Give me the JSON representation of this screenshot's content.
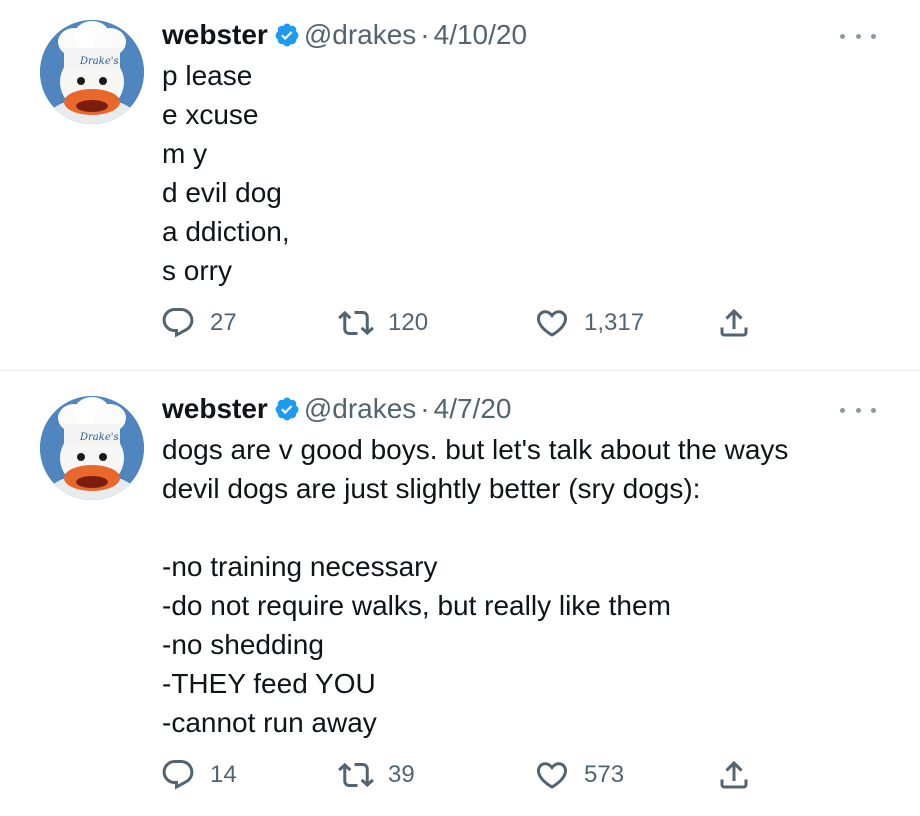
{
  "colors": {
    "text": "#0f1419",
    "secondary": "#536471",
    "verified": "#1d9bf0",
    "divider": "#eff3f4"
  },
  "tweets": [
    {
      "author_name": "webster",
      "handle": "@drakes",
      "separator": "·",
      "date": "4/10/20",
      "lines": [
        "p lease",
        "e xcuse",
        "m y",
        "d evil dog",
        "a ddiction,",
        "s orry"
      ],
      "replies": "27",
      "retweets": "120",
      "likes": "1,317",
      "avatar_text": "Drake's"
    },
    {
      "author_name": "webster",
      "handle": "@drakes",
      "separator": "·",
      "date": "4/7/20",
      "lines": [
        "dogs are v good boys. but let's talk about the ways",
        "devil dogs are just slightly better (sry dogs):",
        "",
        "-no training necessary",
        "-do not require walks, but really like them",
        "-no shedding",
        "-THEY feed YOU",
        "-cannot run away"
      ],
      "replies": "14",
      "retweets": "39",
      "likes": "573",
      "avatar_text": "Drake's"
    }
  ],
  "icons": {
    "reply": "reply-icon",
    "retweet": "retweet-icon",
    "like": "heart-icon",
    "share": "share-icon",
    "verified": "verified-badge-icon",
    "more": "more-options-icon"
  }
}
